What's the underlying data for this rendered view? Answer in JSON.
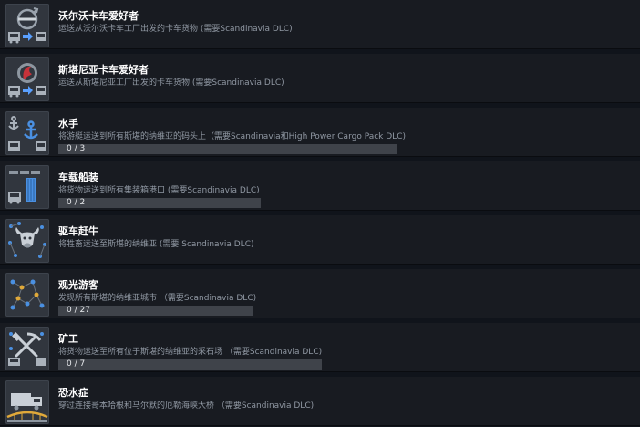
{
  "achievements": [
    {
      "title": "沃尔沃卡车爱好者",
      "description": "运送从沃尔沃卡车工厂出发的卡车货物 (需要Scandinavia DLC)",
      "icon": "volvo-logo-icon"
    },
    {
      "title": "斯堪尼亚卡车爱好者",
      "description": "运送从斯堪尼亚工厂出发的卡车货物 (需要Scandinavia DLC)",
      "icon": "scania-griffin-icon"
    },
    {
      "title": "水手",
      "description": "将游艇运送到所有斯堪的纳维亚的码头上（需要Scandinavia和High Power Cargo Pack DLC)",
      "icon": "anchor-icon",
      "progress": {
        "text": "0 / 3",
        "value": 0,
        "total": 3
      }
    },
    {
      "title": "车载船装",
      "description": "将货物运送到所有集装箱港口 (需要Scandinavia DLC)",
      "icon": "container-ship-icon",
      "progress": {
        "text": "0 / 2",
        "value": 0,
        "total": 2
      }
    },
    {
      "title": "驱车赶牛",
      "description": "将牲畜运送至斯堪的纳维亚 (需要 Scandinavia DLC)",
      "icon": "cattle-icon"
    },
    {
      "title": "观光游客",
      "description": "发现所有斯堪的纳维亚城市 （需要Scandinavia DLC)",
      "icon": "map-cities-icon",
      "progress": {
        "text": "0 / 27",
        "value": 0,
        "total": 27
      }
    },
    {
      "title": "矿工",
      "description": "将货物运送至所有位于斯堪的纳维亚的采石场 （需要Scandinavia DLC)",
      "icon": "mining-pickaxe-icon",
      "progress": {
        "text": "0 / 7",
        "value": 0,
        "total": 7
      }
    },
    {
      "title": "恐水症",
      "description": "穿过连接哥本哈根和马尔默的厄勒海峡大桥 （需要Scandinavia DLC)",
      "icon": "bridge-truck-icon"
    }
  ],
  "colors": {
    "row_background": "#181b21",
    "page_background": "#10141b",
    "progress_track": "#3f434a",
    "title": "#ffffff",
    "description": "#9098a3"
  }
}
